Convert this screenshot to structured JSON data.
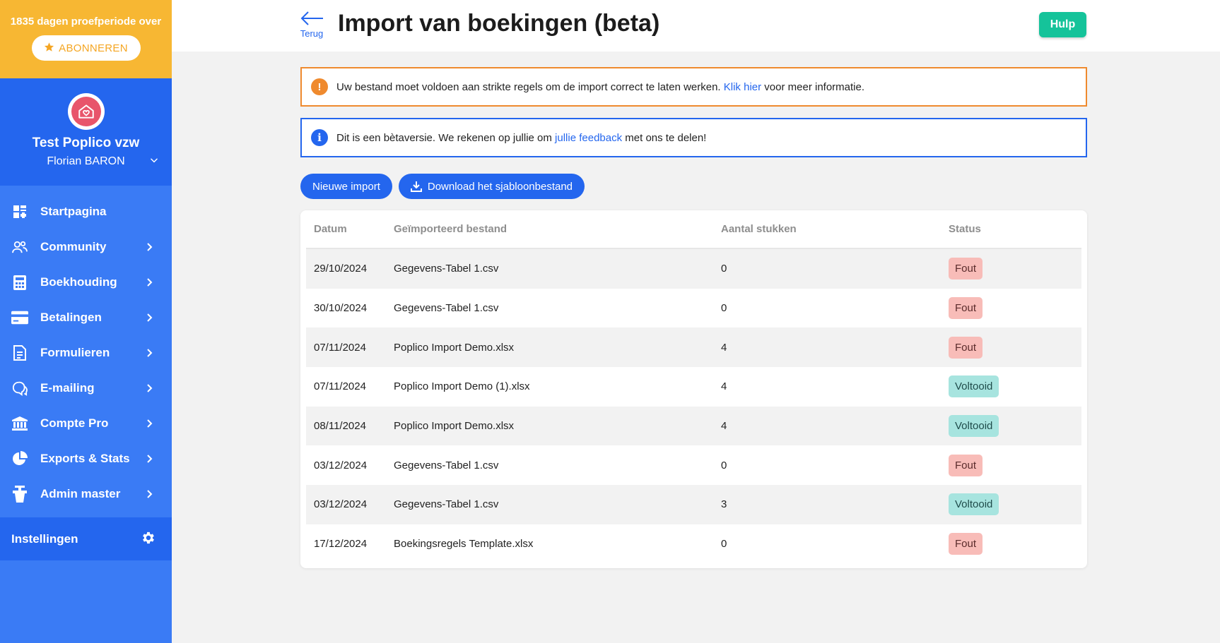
{
  "sidebar": {
    "trial_text": "1835 dagen proefperiode over",
    "subscribe_label": "ABONNEREN",
    "org_name": "Test Poplico vzw",
    "user_name": "Florian BARON",
    "nav": [
      {
        "label": "Startpagina",
        "icon": "dashboard-icon"
      },
      {
        "label": "Community",
        "icon": "community-icon"
      },
      {
        "label": "Boekhouding",
        "icon": "calculator-icon"
      },
      {
        "label": "Betalingen",
        "icon": "credit-card-icon"
      },
      {
        "label": "Formulieren",
        "icon": "document-icon"
      },
      {
        "label": "E-mailing",
        "icon": "chat-icon"
      },
      {
        "label": "Compte Pro",
        "icon": "bank-icon"
      },
      {
        "label": "Exports & Stats",
        "icon": "pie-chart-icon"
      },
      {
        "label": "Admin master",
        "icon": "admin-icon"
      }
    ],
    "settings_label": "Instellingen"
  },
  "header": {
    "back_label": "Terug",
    "title": "Import van boekingen (beta)",
    "help_label": "Hulp"
  },
  "alerts": {
    "warning": {
      "before": "Uw bestand moet voldoen aan strikte regels om de import correct te laten werken. ",
      "link": "Klik hier",
      "after": " voor meer informatie."
    },
    "info": {
      "before": "Dit is een bètaversie. We rekenen op jullie om ",
      "link": "jullie feedback",
      "after": " met ons te delen!"
    }
  },
  "actions": {
    "new_import": "Nieuwe import",
    "download_template": "Download het sjabloonbestand"
  },
  "table": {
    "headers": {
      "date": "Datum",
      "file": "Geïmporteerd bestand",
      "count": "Aantal stukken",
      "status": "Status"
    },
    "rows": [
      {
        "date": "29/10/2024",
        "file": "Gegevens-Tabel 1.csv",
        "count": "0",
        "status": "Fout"
      },
      {
        "date": "30/10/2024",
        "file": "Gegevens-Tabel 1.csv",
        "count": "0",
        "status": "Fout"
      },
      {
        "date": "07/11/2024",
        "file": "Poplico Import Demo.xlsx",
        "count": "4",
        "status": "Fout"
      },
      {
        "date": "07/11/2024",
        "file": "Poplico Import Demo (1).xlsx",
        "count": "4",
        "status": "Voltooid"
      },
      {
        "date": "08/11/2024",
        "file": "Poplico Import Demo.xlsx",
        "count": "4",
        "status": "Voltooid"
      },
      {
        "date": "03/12/2024",
        "file": "Gegevens-Tabel 1.csv",
        "count": "0",
        "status": "Fout"
      },
      {
        "date": "03/12/2024",
        "file": "Gegevens-Tabel 1.csv",
        "count": "3",
        "status": "Voltooid"
      },
      {
        "date": "17/12/2024",
        "file": "Boekingsregels Template.xlsx",
        "count": "0",
        "status": "Fout"
      }
    ]
  },
  "colors": {
    "primary": "#2466ee",
    "sidebar": "#3a7bf5",
    "trial_banner": "#f7b733",
    "help": "#15c39a",
    "warning": "#ef8a2e",
    "error_badge": "#f8bcb8",
    "success_badge": "#a7e4df"
  }
}
